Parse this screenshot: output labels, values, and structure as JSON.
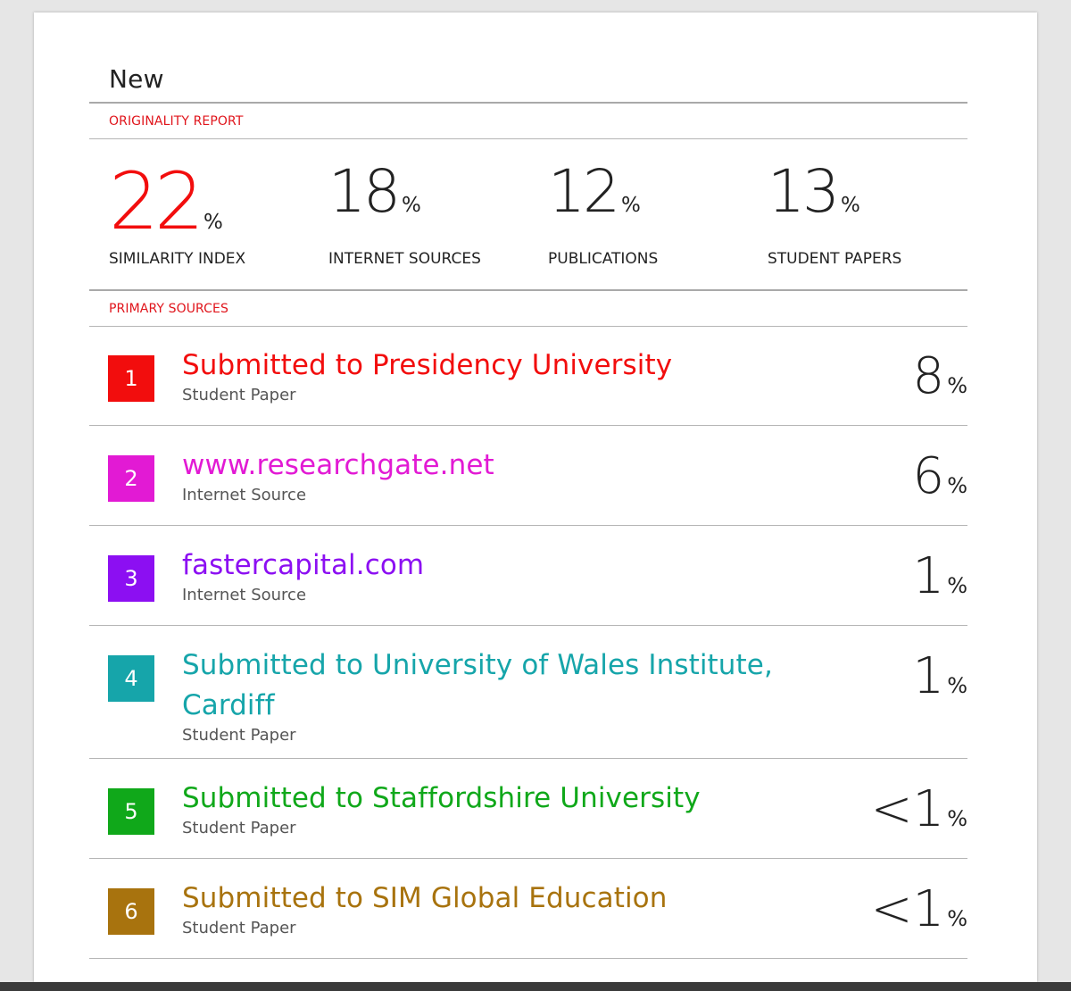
{
  "report": {
    "title": "New",
    "originality_label": "ORIGINALITY REPORT",
    "primary_sources_label": "PRIMARY SOURCES"
  },
  "stats": [
    {
      "value": "22",
      "unit": "%",
      "label": "SIMILARITY INDEX"
    },
    {
      "value": "18",
      "unit": "%",
      "label": "INTERNET SOURCES"
    },
    {
      "value": "12",
      "unit": "%",
      "label": "PUBLICATIONS"
    },
    {
      "value": "13",
      "unit": "%",
      "label": "STUDENT PAPERS"
    }
  ],
  "sources": [
    {
      "rank": "1",
      "name": "Submitted to Presidency University",
      "type": "Student Paper",
      "percent": "8",
      "unit": "%",
      "color": "#f20d0d"
    },
    {
      "rank": "2",
      "name": "www.researchgate.net",
      "type": "Internet Source",
      "percent": "6",
      "unit": "%",
      "color": "#e21ad4"
    },
    {
      "rank": "3",
      "name": "fastercapital.com",
      "type": "Internet Source",
      "percent": "1",
      "unit": "%",
      "color": "#8c0ff2"
    },
    {
      "rank": "4",
      "name": "Submitted to University of Wales Institute, Cardiff",
      "type": "Student Paper",
      "percent": "1",
      "unit": "%",
      "color": "#16a5aa"
    },
    {
      "rank": "5",
      "name": "Submitted to Staffordshire University",
      "type": "Student Paper",
      "percent": "<1",
      "unit": "%",
      "color": "#10a81a"
    },
    {
      "rank": "6",
      "name": "Submitted to SIM Global Education",
      "type": "Student Paper",
      "percent": "<1",
      "unit": "%",
      "color": "#a8730e"
    }
  ]
}
